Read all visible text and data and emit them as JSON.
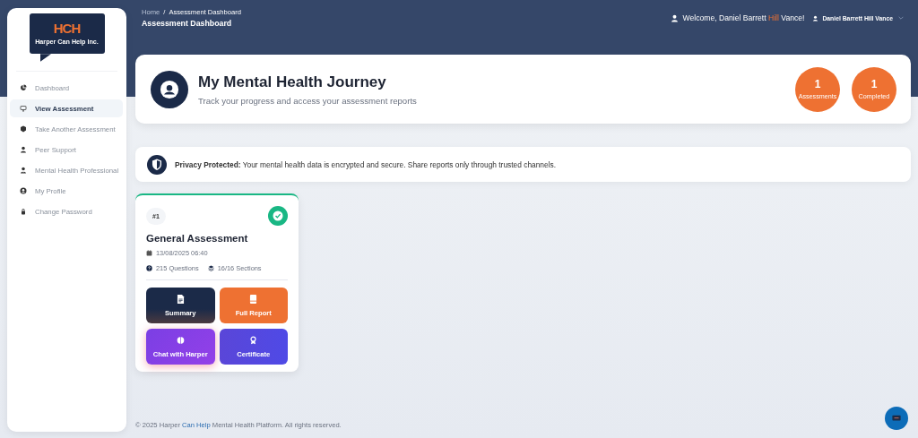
{
  "logo": {
    "mark": "HCH",
    "name": "Harper Can Help Inc."
  },
  "sidebar": {
    "items": [
      {
        "label": "Dashboard",
        "selected": false
      },
      {
        "label": "View Assessment",
        "selected": true
      },
      {
        "label": "Take Another Assessment",
        "selected": false
      },
      {
        "label": "Peer Support",
        "selected": false
      },
      {
        "label": "Mental Health Professional",
        "selected": false
      },
      {
        "label": "My Profile",
        "selected": false
      },
      {
        "label": "Change Password",
        "selected": false
      }
    ]
  },
  "breadcrumb": {
    "items": [
      "Home",
      "Assessment Dashboard"
    ],
    "separator": "/",
    "title": "Assessment Dashboard"
  },
  "user": {
    "welcome_before": "Welcome, Daniel Barrett ",
    "welcome_highlight": "Hill",
    "welcome_after": " Vance!",
    "menu_label": "Daniel Barrett Hill Vance"
  },
  "hero": {
    "title": "My Mental Health Journey",
    "subtitle": "Track your progress and access your assessment reports",
    "stats": [
      {
        "value": "1",
        "label": "Assessments"
      },
      {
        "value": "1",
        "label": "Completed"
      }
    ]
  },
  "privacy": {
    "title": "Privacy Protected:",
    "text": "Your mental health data is encrypted and secure. Share reports only through trusted channels."
  },
  "assessments": [
    {
      "number": "#1",
      "completed": true,
      "title": "General Assessment",
      "date": "13/08/2025 06:40",
      "questions": "215 Questions",
      "sections": "16/16 Sections",
      "actions": [
        {
          "label": "Summary",
          "kind": "summary"
        },
        {
          "label": "Full Report",
          "kind": "report"
        },
        {
          "label": "Chat with Harper",
          "kind": "chat"
        },
        {
          "label": "Certificate",
          "kind": "certificate"
        }
      ]
    }
  ],
  "footer": {
    "before": "© 2025 Harper ",
    "highlight": "Can Help",
    "after": " Mental Health Platform. All rights reserved."
  }
}
